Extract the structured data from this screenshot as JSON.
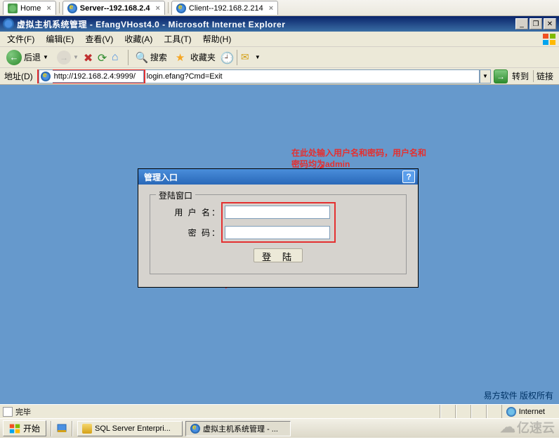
{
  "tabs": [
    {
      "label": "Home",
      "icon": "home"
    },
    {
      "label": "Server--192.168.2.4",
      "icon": "ie",
      "active": true
    },
    {
      "label": "Client--192.168.2.214",
      "icon": "ie"
    }
  ],
  "title_bar": "虚拟主机系统管理 - EfangVHost4.0 - Microsoft Internet Explorer",
  "menus": {
    "file": "文件(F)",
    "edit": "编辑(E)",
    "view": "查看(V)",
    "fav": "收藏(A)",
    "tools": "工具(T)",
    "help": "帮助(H)"
  },
  "toolbar": {
    "back": "后退",
    "search": "搜索",
    "favorites": "收藏夹"
  },
  "address": {
    "label": "地址(D)",
    "url_highlighted": "http://192.168.2.4:9999/",
    "url_rest": "login.efang?Cmd=Exit",
    "go": "转到",
    "links": "链接"
  },
  "annotation": "在此处输入用户名和密码，用户名和密码均为admin",
  "panel": {
    "title": "管理入口",
    "fieldset": "登陆窗口",
    "username_label": "用 户 名：",
    "password_label": "密    码：",
    "login_btn": "登 陆"
  },
  "footer": "易方软件 版权所有",
  "status": {
    "done": "完毕",
    "zone": "Internet"
  },
  "taskbar": {
    "start": "开始",
    "items": [
      {
        "label": "SQL Server Enterpri...",
        "icon": "sql"
      },
      {
        "label": "虚拟主机系统管理 - ...",
        "icon": "ie",
        "active": true
      }
    ]
  },
  "watermark": "亿速云"
}
